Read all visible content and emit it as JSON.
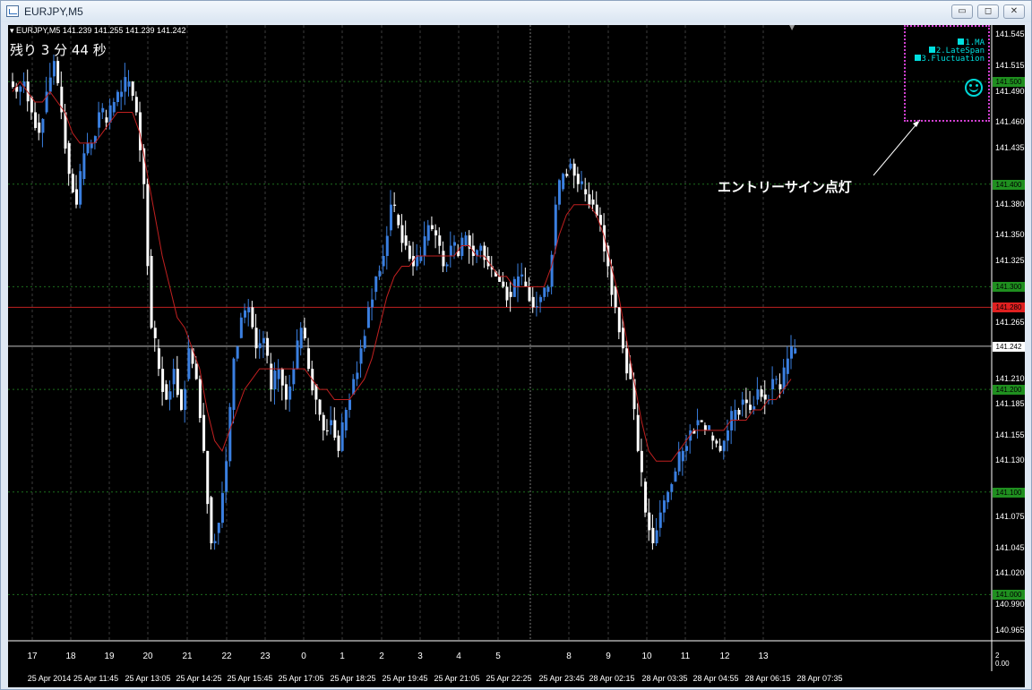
{
  "window": {
    "title": "EURJPY,M5",
    "minimize_icon": "minimize-icon",
    "maximize_icon": "restore-icon",
    "close_icon": "close-icon"
  },
  "chart": {
    "symbol_info": "▾ EURJPY,M5  141.239 141.255 141.239 141.242",
    "remaining_label": "残り 3 分 44 秒",
    "annotation": "エントリーサイン点灯",
    "indicators": [
      "1.MA",
      "2.LateSpan",
      "3.Fluctuation"
    ],
    "smiley_icon": "smiley-icon",
    "bottom_right": "2\n0.00"
  },
  "price_axis": {
    "ticks": [
      "141.545",
      "141.515",
      "141.490",
      "141.460",
      "141.435",
      "141.380",
      "141.350",
      "141.325",
      "141.265",
      "141.210",
      "141.185",
      "141.155",
      "141.130",
      "141.075",
      "141.045",
      "141.020",
      "140.990",
      "140.965"
    ],
    "labels": [
      {
        "text": "141.500",
        "color": "#1f8f1f"
      },
      {
        "text": "141.400",
        "color": "#1f8f1f"
      },
      {
        "text": "141.300",
        "color": "#1f8f1f"
      },
      {
        "text": "141.280",
        "color": "#e02020"
      },
      {
        "text": "141.242",
        "color": "#ffffff"
      },
      {
        "text": "141.200",
        "color": "#1f8f1f"
      },
      {
        "text": "141.100",
        "color": "#1f8f1f"
      },
      {
        "text": "141.000",
        "color": "#1f8f1f"
      }
    ]
  },
  "time_axis": {
    "hour_labels": [
      "17",
      "18",
      "19",
      "20",
      "21",
      "22",
      "23",
      "0",
      "1",
      "2",
      "3",
      "4",
      "5",
      "8",
      "9",
      "10",
      "11",
      "12",
      "13"
    ],
    "date_labels": [
      "25 Apr 2014",
      "25 Apr 11:45",
      "25 Apr 13:05",
      "25 Apr 14:25",
      "25 Apr 15:45",
      "25 Apr 17:05",
      "25 Apr 18:25",
      "25 Apr 19:45",
      "25 Apr 21:05",
      "25 Apr 22:25",
      "25 Apr 23:45",
      "28 Apr 02:15",
      "28 Apr 03:35",
      "28 Apr 04:55",
      "28 Apr 06:15",
      "28 Apr 07:35"
    ]
  },
  "colors": {
    "background": "#000000",
    "bull_candle": "#3a7fe0",
    "bear_candle": "#ffffff",
    "ma_line": "#c02020",
    "red_level_line": "#c02020",
    "current_price_line": "#c0c0c0",
    "grid": "#4a4a4a"
  },
  "chart_data": {
    "type": "candlestick",
    "symbol": "EURJPY",
    "timeframe": "M5",
    "ylim": [
      140.955,
      141.555
    ],
    "current_price": 141.242,
    "red_level": 141.28,
    "close_series": [
      141.49,
      141.5,
      141.47,
      141.45,
      141.49,
      141.52,
      141.47,
      141.41,
      141.38,
      141.43,
      141.44,
      141.47,
      141.46,
      141.48,
      141.49,
      141.5,
      141.47,
      141.4,
      141.26,
      141.22,
      141.19,
      141.22,
      141.18,
      141.24,
      141.21,
      141.14,
      141.05,
      141.07,
      141.13,
      141.23,
      141.27,
      141.28,
      141.24,
      141.25,
      141.2,
      141.22,
      141.19,
      141.22,
      141.26,
      141.22,
      141.19,
      141.16,
      141.17,
      141.14,
      141.18,
      141.21,
      141.24,
      141.28,
      141.31,
      141.33,
      141.38,
      141.36,
      141.34,
      141.32,
      141.33,
      141.36,
      141.35,
      141.32,
      141.34,
      141.33,
      141.35,
      141.33,
      141.34,
      141.32,
      141.31,
      141.3,
      141.29,
      141.31,
      141.3,
      141.28,
      141.29,
      141.3,
      141.38,
      141.41,
      141.42,
      141.4,
      141.39,
      141.38,
      141.36,
      141.32,
      141.28,
      141.24,
      141.21,
      141.14,
      141.08,
      141.05,
      141.08,
      141.1,
      141.12,
      141.14,
      141.16,
      141.17,
      141.16,
      141.15,
      141.14,
      141.16,
      141.18,
      141.19,
      141.18,
      141.2,
      141.19,
      141.21,
      141.2,
      141.23,
      141.24
    ],
    "ma_series": [
      141.49,
      141.5,
      141.49,
      141.48,
      141.48,
      141.49,
      141.48,
      141.47,
      141.45,
      141.44,
      141.44,
      141.44,
      141.45,
      141.46,
      141.47,
      141.47,
      141.47,
      141.45,
      141.41,
      141.37,
      141.33,
      141.3,
      141.27,
      141.26,
      141.24,
      141.22,
      141.18,
      141.15,
      141.14,
      141.16,
      141.18,
      141.2,
      141.21,
      141.22,
      141.22,
      141.22,
      141.22,
      141.22,
      141.22,
      141.22,
      141.21,
      141.2,
      141.2,
      141.19,
      141.19,
      141.19,
      141.2,
      141.21,
      141.23,
      141.26,
      141.29,
      141.31,
      141.32,
      141.32,
      141.33,
      141.33,
      141.33,
      141.33,
      141.33,
      141.33,
      141.34,
      141.34,
      141.33,
      141.33,
      141.32,
      141.31,
      141.31,
      141.3,
      141.3,
      141.3,
      141.3,
      141.3,
      141.32,
      141.35,
      141.37,
      141.38,
      141.38,
      141.38,
      141.37,
      141.35,
      141.32,
      141.29,
      141.25,
      141.21,
      141.17,
      141.14,
      141.13,
      141.13,
      141.13,
      141.14,
      141.15,
      141.16,
      141.16,
      141.16,
      141.16,
      141.16,
      141.17,
      141.17,
      141.17,
      141.18,
      141.18,
      141.19,
      141.19,
      141.2,
      141.21
    ]
  }
}
